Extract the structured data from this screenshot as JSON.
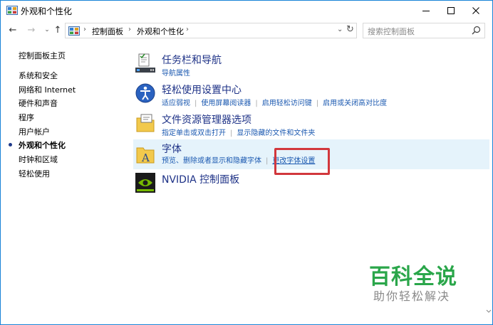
{
  "window": {
    "title": "外观和个性化",
    "minimize_glyph": "─",
    "maximize_glyph": "☐",
    "close_glyph": "✕"
  },
  "nav": {
    "back_glyph": "←",
    "forward_glyph": "→",
    "recent_glyph": "⌄",
    "up_glyph": "↑"
  },
  "address": {
    "crumbs": [
      "控制面板",
      "外观和个性化"
    ],
    "separator": "›",
    "dropdown_glyph": "⌄",
    "refresh_glyph": "↻"
  },
  "search": {
    "placeholder": "搜索控制面板"
  },
  "sidebar": {
    "home": "控制面板主页",
    "items": [
      {
        "label": "系统和安全",
        "active": false
      },
      {
        "label": "网络和 Internet",
        "active": false
      },
      {
        "label": "硬件和声音",
        "active": false
      },
      {
        "label": "程序",
        "active": false
      },
      {
        "label": "用户帐户",
        "active": false
      },
      {
        "label": "外观和个性化",
        "active": true
      },
      {
        "label": "时钟和区域",
        "active": false
      },
      {
        "label": "轻松使用",
        "active": false
      }
    ]
  },
  "categories": [
    {
      "title": "任务栏和导航",
      "links": [
        "导航属性"
      ]
    },
    {
      "title": "轻松使用设置中心",
      "links": [
        "适应弱视",
        "使用屏幕阅读器",
        "启用轻松访问键",
        "启用或关闭高对比度"
      ]
    },
    {
      "title": "文件资源管理器选项",
      "links": [
        "指定单击或双击打开",
        "显示隐藏的文件和文件夹"
      ]
    },
    {
      "title": "字体",
      "links": [
        "预览、删除或者显示和隐藏字体",
        "更改字体设置"
      ]
    },
    {
      "title": "NVIDIA 控制面板",
      "links": []
    }
  ],
  "watermark": {
    "title": "百科全说",
    "subtitle": "助你轻松解决"
  },
  "colors": {
    "accent": "#1883d7",
    "link": "#1a58b0",
    "category_title": "#1e3287",
    "highlight_bg": "#e5f3fb",
    "annotation_red": "#d2373c",
    "watermark_green": "#2aa64a"
  }
}
